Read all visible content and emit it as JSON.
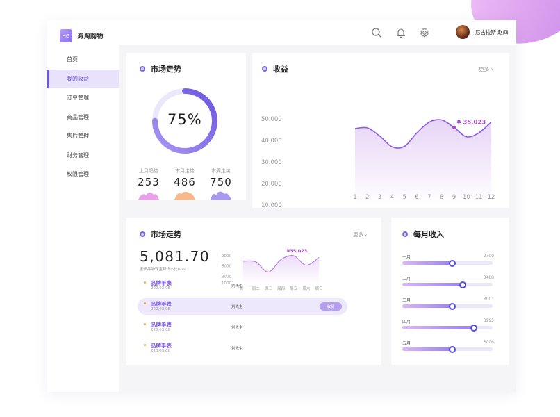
{
  "app": {
    "logo_badge": "HG",
    "logo_text": "海淘购物"
  },
  "sidebar": {
    "items": [
      {
        "label": "首页",
        "active": false
      },
      {
        "label": "我的收益",
        "active": true
      },
      {
        "label": "订单管理",
        "active": false
      },
      {
        "label": "商品管理",
        "active": false
      },
      {
        "label": "售后管理",
        "active": false
      },
      {
        "label": "财务管理",
        "active": false
      },
      {
        "label": "权限管理",
        "active": false
      }
    ]
  },
  "header": {
    "icons": [
      "search-icon",
      "bell-icon",
      "gear-icon"
    ],
    "user_name": "尼古拉斯 赵四"
  },
  "market_card": {
    "title": "市场走势",
    "ring_percent": 75,
    "ring_label": "75%",
    "stats": [
      {
        "label": "上月趋势",
        "value": "253",
        "color": "#e9a0e8"
      },
      {
        "label": "本月走势",
        "value": "486",
        "color": "#f8b98a"
      },
      {
        "label": "本周走势",
        "value": "750",
        "color": "#a99af0"
      }
    ]
  },
  "income_card": {
    "title": "收益",
    "more": "更多 ›",
    "highlight_label": "¥ 35,023"
  },
  "market_card2": {
    "title": "市场走势",
    "more": "更多 ›",
    "big_number": "5,081.70",
    "caption": "奢侈品和珠宝首饰占比60%",
    "highlight_label": "¥35,023",
    "mini_y": [
      "9000",
      "6000",
      "3000",
      "1000"
    ],
    "mini_x": [
      "周一",
      "周二",
      "周三",
      "周四",
      "周五",
      "周六",
      "周日"
    ],
    "orders": [
      {
        "name": "品牌手表",
        "date": "220,03,08",
        "buyer": "刘先生",
        "button": "",
        "active": false
      },
      {
        "name": "品牌手表",
        "date": "220,03,08",
        "buyer": "刘先生",
        "button": "收货",
        "active": true
      },
      {
        "name": "品牌手表",
        "date": "220,03,08",
        "buyer": "刘先生",
        "button": "",
        "active": false
      },
      {
        "name": "品牌手表",
        "date": "220,03,08",
        "buyer": "刘先生",
        "button": "",
        "active": false
      }
    ]
  },
  "monthly_card": {
    "title": "每月收入",
    "months": [
      {
        "label": "一月",
        "value": "2700",
        "level": 0.55
      },
      {
        "label": "二月",
        "value": "3488",
        "level": 0.67
      },
      {
        "label": "三月",
        "value": "3001",
        "level": 0.55
      },
      {
        "label": "四月",
        "value": "3995",
        "level": 0.79
      },
      {
        "label": "五月",
        "value": "3006",
        "level": 0.55
      }
    ]
  },
  "chart_data": [
    {
      "type": "area",
      "title": "收益",
      "x": [
        "1",
        "2",
        "3",
        "4",
        "5",
        "6",
        "7",
        "8",
        "9",
        "10",
        "11",
        "12"
      ],
      "y_ticks": [
        "50.000",
        "40.000",
        "30.000",
        "20.000",
        "10.000"
      ],
      "ylim": [
        10000,
        50000
      ],
      "series": [
        {
          "values": [
            45500,
            45800,
            42000,
            37000,
            37300,
            43500,
            48500,
            49500,
            46000,
            41700,
            43500,
            48500
          ]
        }
      ],
      "highlight": {
        "x": "9",
        "label": "¥ 35,023"
      },
      "colors": {
        "line": "#8a5ce0",
        "fill_top": "#e7d4f6",
        "fill_bottom": "#ffffff",
        "highlight": "#a645c9"
      }
    },
    {
      "type": "area",
      "x": [
        "周一",
        "周二",
        "周三",
        "周四",
        "周五",
        "周六",
        "周日"
      ],
      "y_ticks": [
        "9000",
        "6000",
        "3000",
        "1000"
      ],
      "ylim": [
        1000,
        9000
      ],
      "series": [
        {
          "values": [
            7200,
            7000,
            4000,
            7700,
            8800,
            6000,
            8300
          ]
        }
      ],
      "highlight": {
        "x": "周五",
        "label": "¥35,023"
      },
      "colors": {
        "line": "#b07ce6",
        "fill_top": "#ecdcf8",
        "fill_bottom": "#ffffff",
        "highlight": "#a645c9"
      }
    },
    {
      "type": "bar",
      "categories": [
        "一月",
        "二月",
        "三月",
        "四月",
        "五月"
      ],
      "values": [
        2700,
        3488,
        3001,
        3995,
        3006
      ]
    }
  ]
}
